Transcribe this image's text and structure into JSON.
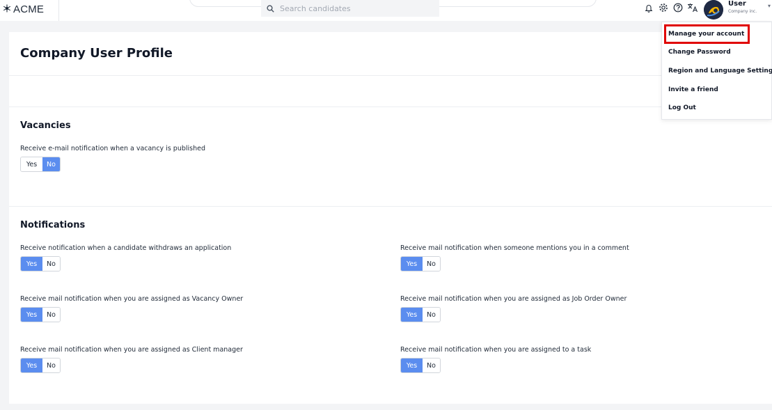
{
  "header": {
    "logo_text": "ACME",
    "logo_icon": "snowflake-icon",
    "search_placeholder": "Search candidates",
    "icons": [
      "bell-icon",
      "gear-icon",
      "help-icon",
      "translate-icon"
    ],
    "user": {
      "name": "User",
      "company": "Company inc."
    }
  },
  "page": {
    "title": "Company User Profile"
  },
  "vacancies": {
    "title": "Vacancies",
    "items": [
      {
        "label": "Receive e-mail notification when a vacancy is published",
        "value": "No"
      }
    ]
  },
  "notifications": {
    "title": "Notifications",
    "items": [
      {
        "label": "Receive notification when a candidate withdraws an application",
        "value": "Yes"
      },
      {
        "label": "Receive mail notification when someone mentions you in a comment",
        "value": "Yes"
      },
      {
        "label": "Receive mail notification when you are assigned as Vacancy Owner",
        "value": "Yes"
      },
      {
        "label": "Receive mail notification when you are assigned as Job Order Owner",
        "value": "Yes"
      },
      {
        "label": "Receive mail notification when you are assigned as Client manager",
        "value": "Yes"
      },
      {
        "label": "Receive mail notification when you are assigned to a task",
        "value": "Yes"
      }
    ]
  },
  "toggle_labels": {
    "yes": "Yes",
    "no": "No"
  },
  "user_menu": {
    "items": [
      "Manage your account",
      "Change Password",
      "Region and Language Settings",
      "Invite a friend",
      "Log Out"
    ],
    "highlighted": "Manage your account"
  },
  "colors": {
    "accent": "#5b8def",
    "highlight": "#e00000"
  }
}
